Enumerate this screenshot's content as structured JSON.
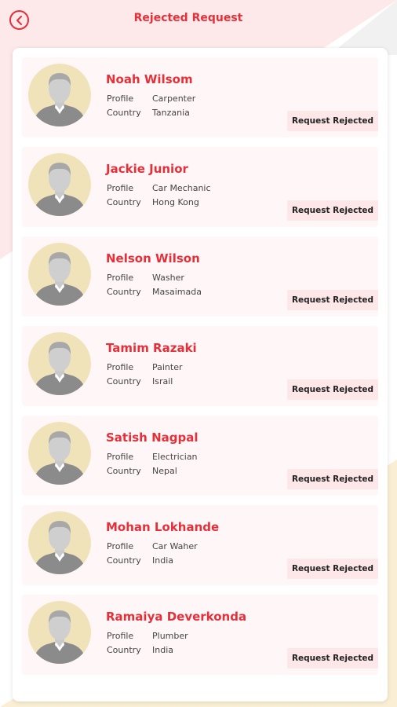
{
  "header": {
    "title": "Rejected Request"
  },
  "labels": {
    "profile": "Profile",
    "country": "Country"
  },
  "requests": [
    {
      "name": "Noah Wilsom",
      "profile": "Carpenter",
      "country": "Tanzania",
      "status": "Request Rejected"
    },
    {
      "name": "Jackie Junior",
      "profile": "Car Mechanic",
      "country": "Hong Kong",
      "status": "Request Rejected"
    },
    {
      "name": "Nelson Wilson",
      "profile": "Washer",
      "country": "Masaimada",
      "status": "Request Rejected"
    },
    {
      "name": "Tamim Razaki",
      "profile": "Painter",
      "country": "Israil",
      "status": "Request Rejected"
    },
    {
      "name": "Satish Nagpal",
      "profile": "Electrician",
      "country": "Nepal",
      "status": "Request Rejected"
    },
    {
      "name": "Mohan Lokhande",
      "profile": "Car Waher",
      "country": "India",
      "status": "Request Rejected"
    },
    {
      "name": "Ramaiya Deverkonda",
      "profile": "Plumber",
      "country": "India",
      "status": "Request Rejected"
    }
  ],
  "icons": {
    "back": "chevron-left-icon",
    "avatar": "user-silhouette-icon"
  },
  "colors": {
    "accent": "#e5303a",
    "item_bg": "#fff7f7",
    "avatar_bg": "#f1e3b9",
    "status_bg": "#fde7e8"
  }
}
